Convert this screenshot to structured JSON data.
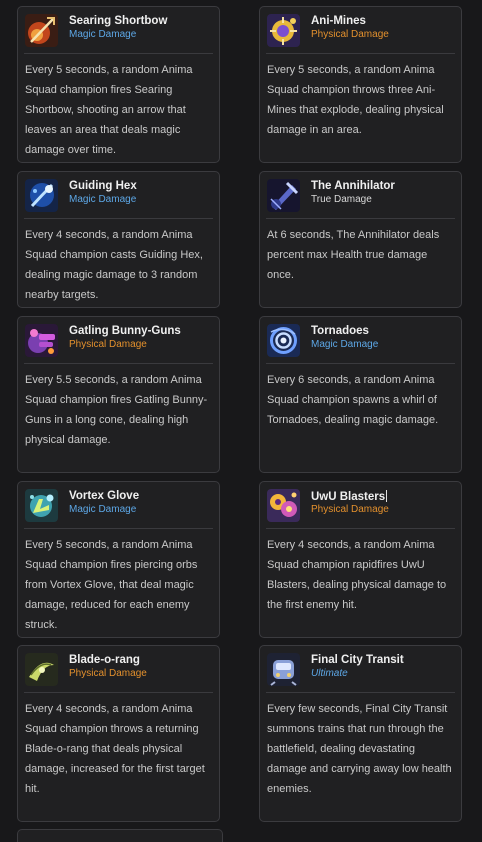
{
  "cards": [
    {
      "title": "Searing Shortbow",
      "type": "Magic Damage",
      "description": "Every 5 seconds, a random Anima Squad champion fires Searing Shortbow, shooting an arrow that leaves an area that deals magic damage over time.",
      "icon": "shortbow-icon"
    },
    {
      "title": "Ani-Mines",
      "type": "Physical Damage",
      "description": "Every 5 seconds, a random Anima Squad champion throws three Ani-Mines that explode, dealing physical damage in an area.",
      "icon": "mines-icon"
    },
    {
      "title": "Guiding Hex",
      "type": "Magic Damage",
      "description": "Every 4 seconds, a random Anima Squad champion casts Guiding Hex, dealing magic damage to 3 random nearby targets.",
      "icon": "hex-icon"
    },
    {
      "title": "The Annihilator",
      "type": "True Damage",
      "description": "At 6 seconds, The Annihilator deals percent max Health true damage once.",
      "icon": "annihilator-icon"
    },
    {
      "title": "Gatling Bunny-Guns",
      "type": "Physical Damage",
      "description": "Every 5.5 seconds, a random Anima Squad champion fires Gatling Bunny-Guns in a long cone, dealing high physical damage.",
      "icon": "bunny-guns-icon"
    },
    {
      "title": "Tornadoes",
      "type": "Magic Damage",
      "description": "Every 6 seconds, a random Anima Squad champion spawns a whirl of Tornadoes, dealing magic damage.",
      "icon": "tornado-icon"
    },
    {
      "title": "Vortex Glove",
      "type": "Magic Damage",
      "description": "Every 5 seconds, a random Anima Squad champion fires piercing orbs from Vortex Glove, that deal magic damage, reduced for each enemy struck.",
      "icon": "vortex-glove-icon"
    },
    {
      "title": "UwU Blasters",
      "type": "Physical Damage",
      "description": "Every 4 seconds, a random Anima Squad champion rapidfires UwU Blasters, dealing physical damage to the first enemy hit.",
      "icon": "blasters-icon"
    },
    {
      "title": "Blade-o-rang",
      "type": "Physical Damage",
      "description": "Every 4 seconds, a random Anima Squad champion throws a returning Blade-o-rang that deals physical damage, increased for the first target hit.",
      "icon": "bladerang-icon"
    },
    {
      "title": "Final City Transit",
      "type": "Ultimate",
      "description": "Every few seconds, Final City Transit summons trains that run through the battlefield, dealing devastating damage and carrying away low health enemies.",
      "icon": "train-icon"
    }
  ]
}
